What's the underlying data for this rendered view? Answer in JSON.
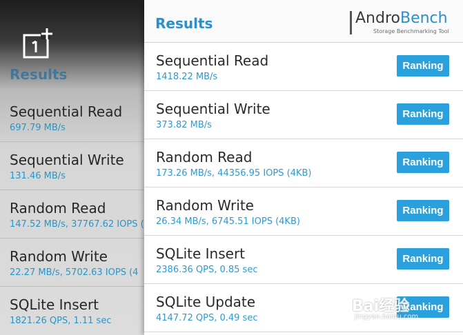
{
  "background_app": {
    "results_title": "Results",
    "items": [
      {
        "title": "Sequential Read",
        "value": "697.79 MB/s"
      },
      {
        "title": "Sequential Write",
        "value": "131.46 MB/s"
      },
      {
        "title": "Random Read",
        "value": "147.52 MB/s, 37767.62 IOPS ("
      },
      {
        "title": "Random Write",
        "value": "22.27 MB/s, 5702.63 IOPS (4"
      },
      {
        "title": "SQLite Insert",
        "value": "1821.26 QPS, 1.11 sec"
      }
    ]
  },
  "header": {
    "title": "Results",
    "brand_andro": "Andro",
    "brand_bench": "Bench",
    "brand_tagline": "Storage Benchmarking Tool"
  },
  "results": [
    {
      "title": "Sequential Read",
      "value": "1418.22 MB/s",
      "button": "Ranking"
    },
    {
      "title": "Sequential Write",
      "value": "373.82 MB/s",
      "button": "Ranking"
    },
    {
      "title": "Random Read",
      "value": "173.26 MB/s, 44356.95 IOPS (4KB)",
      "button": "Ranking"
    },
    {
      "title": "Random Write",
      "value": "26.34 MB/s, 6745.51 IOPS (4KB)",
      "button": "Ranking"
    },
    {
      "title": "SQLite Insert",
      "value": "2386.36 QPS, 0.85 sec",
      "button": "Ranking"
    },
    {
      "title": "SQLite Update",
      "value": "4147.72 QPS, 0.49 sec",
      "button": "Ranking"
    }
  ],
  "watermark": {
    "text": "Bai经验",
    "url": "jingyan.baidu.com"
  },
  "colors": {
    "accent": "#2aa0dc",
    "value_text": "#2d9ad0"
  }
}
